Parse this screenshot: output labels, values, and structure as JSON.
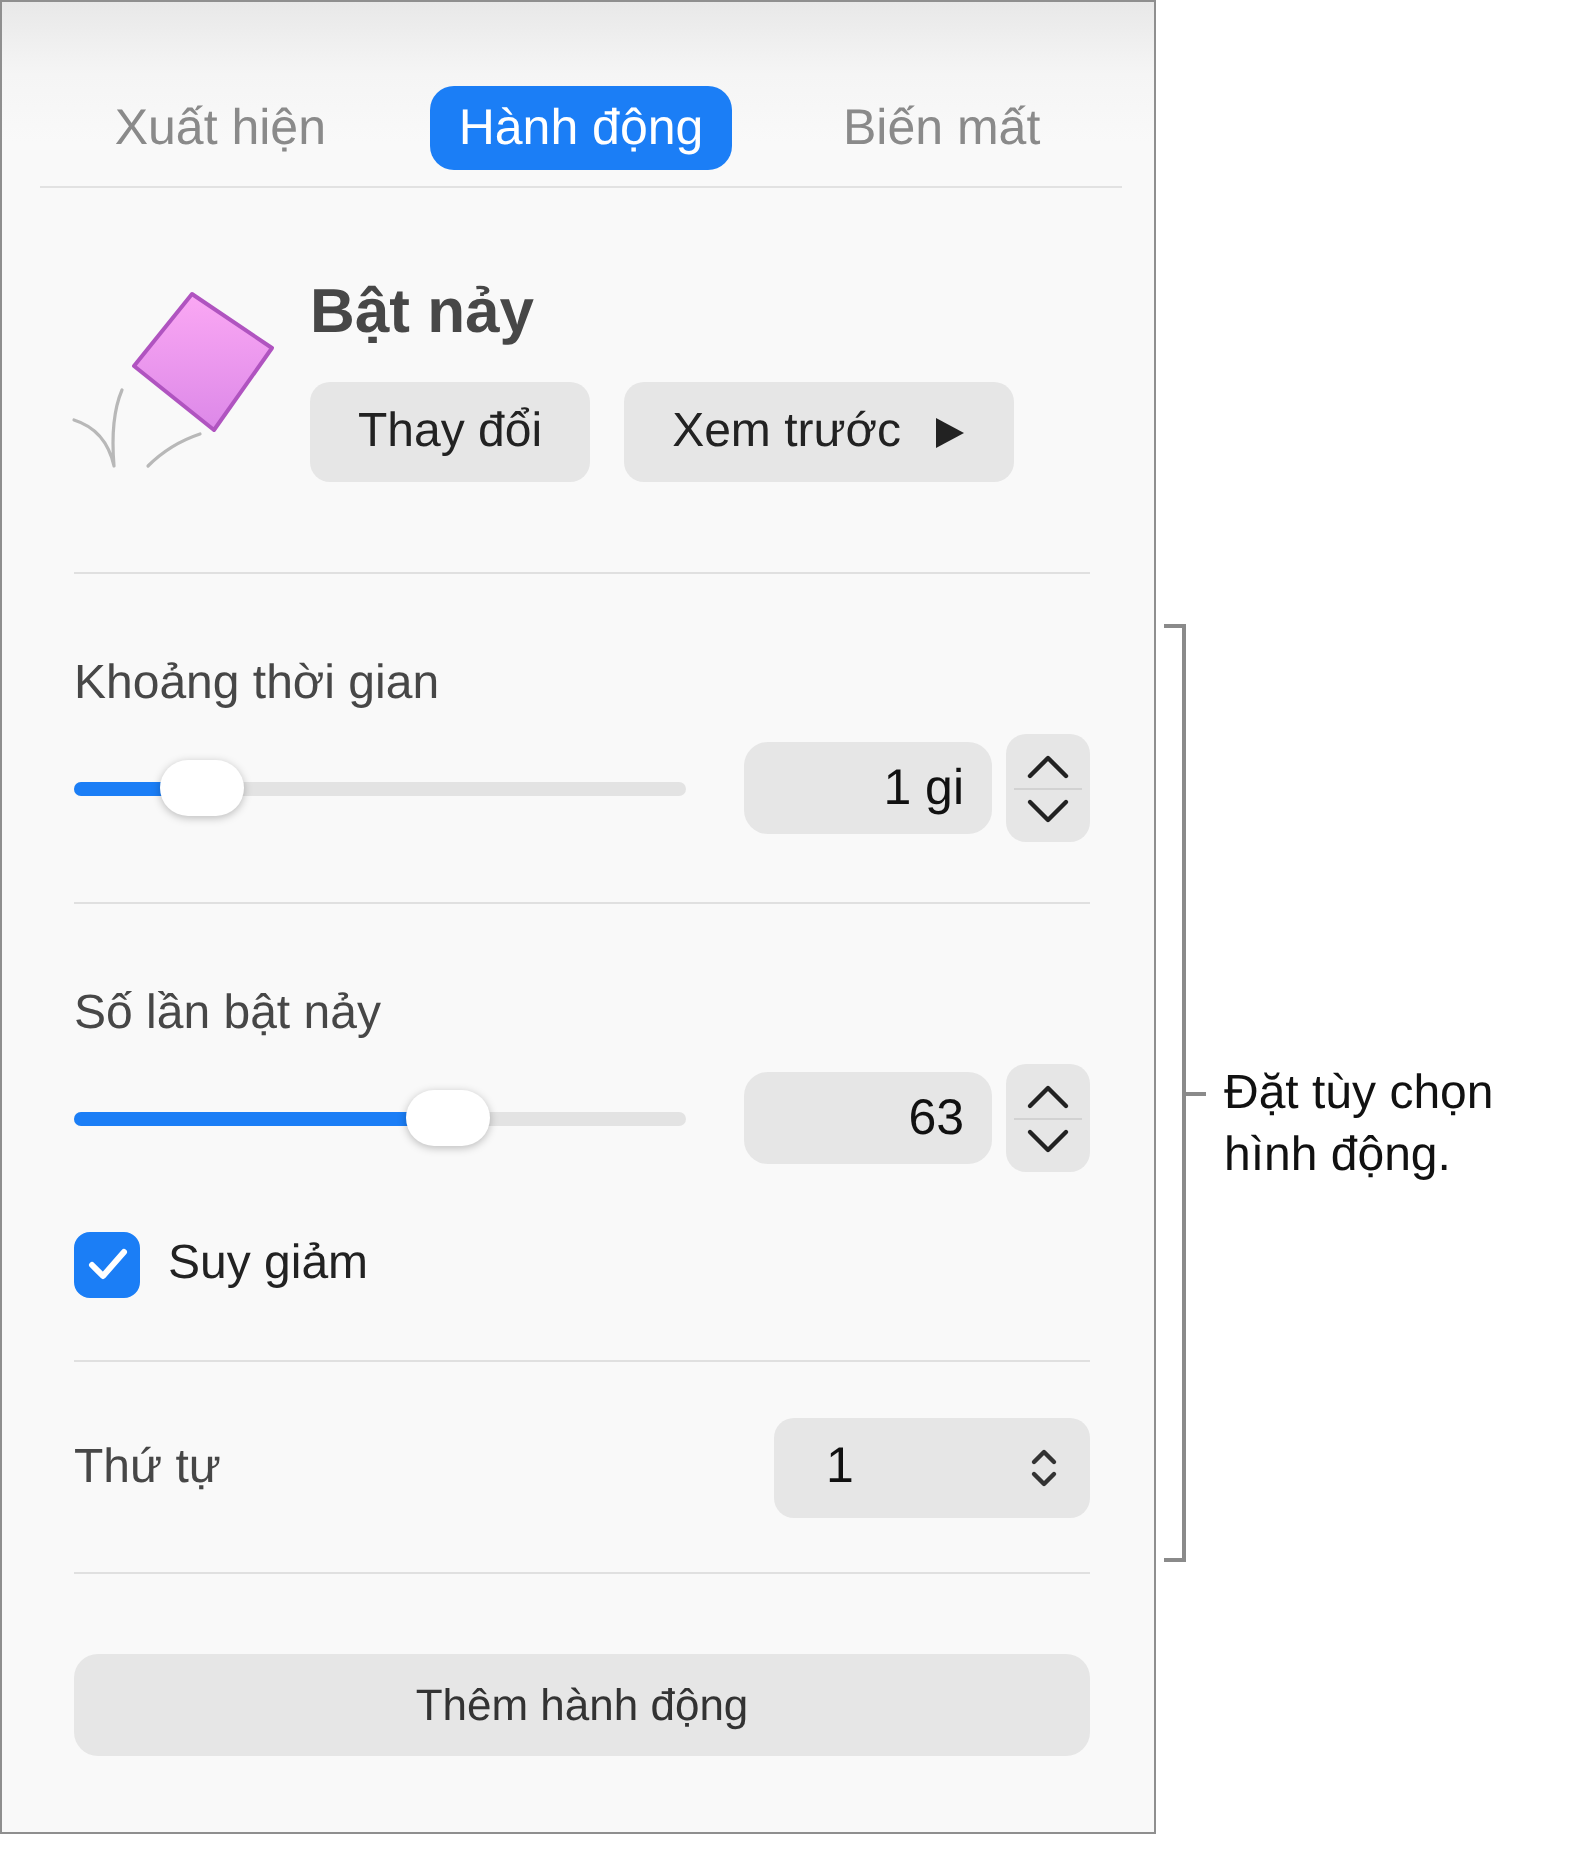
{
  "tabs": [
    {
      "label": "Xuất hiện",
      "selected": false
    },
    {
      "label": "Hành động",
      "selected": true
    },
    {
      "label": "Biến mất",
      "selected": false
    }
  ],
  "effect": {
    "title": "Bật nảy",
    "buttons": [
      {
        "label": "Thay đổi",
        "kind": "plain"
      },
      {
        "label": "Xem trước",
        "kind": "preview"
      }
    ]
  },
  "sections": [
    {
      "controls": [
        {
          "kind": "slider",
          "label": "Khoảng thời gian",
          "level": 0.21,
          "value": "1 gi"
        }
      ]
    },
    {
      "controls": [
        {
          "kind": "slider",
          "label": "Số lần bật nảy",
          "level": 0.61,
          "value": "63"
        },
        {
          "kind": "checkbox",
          "label": "Suy giảm",
          "checked": true
        }
      ]
    },
    {
      "controls": [
        {
          "kind": "select",
          "label": "Thứ tự",
          "value": "1"
        }
      ]
    }
  ],
  "add_button": {
    "label": "Thêm hành động"
  },
  "callout": {
    "text": "Đặt tùy chọn hình động."
  }
}
